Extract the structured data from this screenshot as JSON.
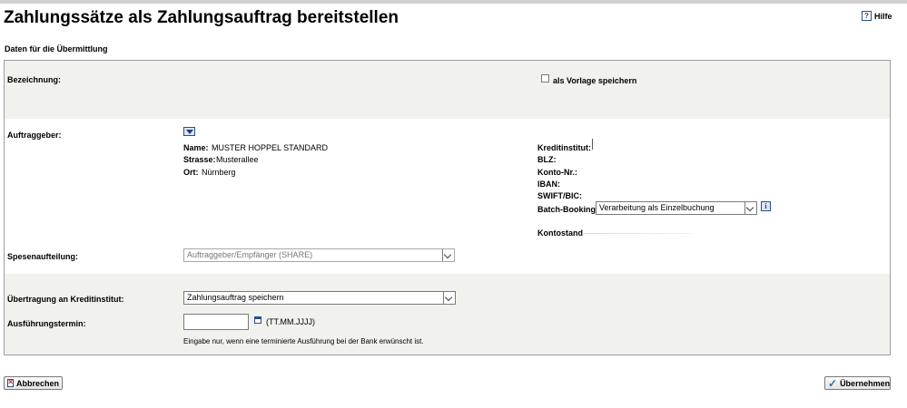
{
  "page": {
    "title": "Zahlungssätze als Zahlungsauftrag bereitstellen",
    "help_label": "Hilfe",
    "help_icon": "help-icon",
    "section_title": "Daten für die Übermittlung"
  },
  "form": {
    "bezeichnung_label": "Bezeichnung:",
    "vorlage_label": "als Vorlage speichern",
    "vorlage_checked": false,
    "auftraggeber_label": "Auftraggeber:",
    "auftraggeber_dropdown_icon": "dropdown-arrow-icon",
    "name_label": "Name:",
    "name_value": "MUSTER HOPPEL STANDARD",
    "strasse_label": "Strasse:",
    "strasse_value": "Musterallee",
    "ort_label": "Ort:",
    "ort_value": "Nürnberg",
    "kreditinstitut_label": "Kreditinstitut:",
    "blz_label": "BLZ:",
    "konto_label": "Konto-Nr.:",
    "iban_label": "IBAN:",
    "swift_label": "SWIFT/BIC:",
    "batch_label": "Batch-Booking:",
    "batch_value": "Verarbeitung als Einzelbuchung",
    "batch_info_icon": "info-icon",
    "kontostand_label": "Kontostand",
    "spesen_label": "Spesenaufteilung:",
    "spesen_value": "Auftraggeber/Empfänger (SHARE)",
    "uebertragung_label": "Übertragung an Kreditinstitut:",
    "uebertragung_value": "Zahlungsauftrag speichern",
    "termin_label": "Ausführungstermin:",
    "termin_value": "",
    "termin_format": "(TT.MM.JJJJ)",
    "termin_hint": "Eingabe nur, wenn eine terminierte Ausführung bei der Bank erwünscht ist."
  },
  "buttons": {
    "cancel_label": "Abbrechen",
    "submit_label": "Übernehmen"
  }
}
